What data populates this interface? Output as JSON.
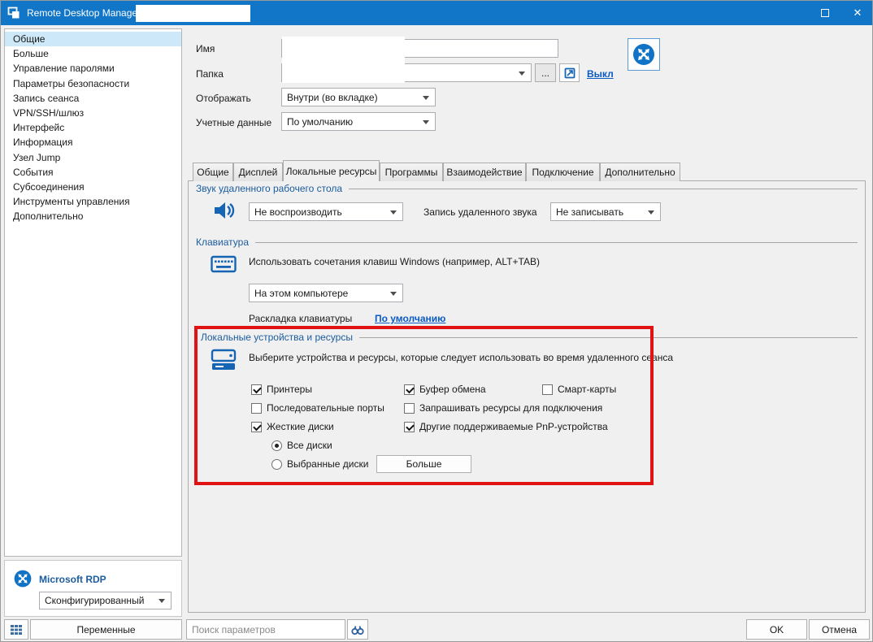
{
  "colors": {
    "titlebar_blue": "#1176c8",
    "accent_blue": "#1565b4",
    "annotation_red": "#e11212",
    "selection_blue": "#cde8f9",
    "group_header_blue": "#1b5c9e"
  },
  "titlebar": {
    "title": "Remote Desktop Manager -",
    "close_glyph": "✕"
  },
  "sidebar": {
    "items": [
      {
        "label": "Общие",
        "selected": true
      },
      {
        "label": "Больше",
        "selected": false
      },
      {
        "label": "Управление паролями",
        "selected": false
      },
      {
        "label": "Параметры безопасности",
        "selected": false
      },
      {
        "label": "Запись сеанса",
        "selected": false
      },
      {
        "label": "VPN/SSH/шлюз",
        "selected": false
      },
      {
        "label": "Интерфейс",
        "selected": false
      },
      {
        "label": "Информация",
        "selected": false
      },
      {
        "label": "Узел Jump",
        "selected": false
      },
      {
        "label": "События",
        "selected": false
      },
      {
        "label": "Субсоединения",
        "selected": false
      },
      {
        "label": "Инструменты управления",
        "selected": false
      },
      {
        "label": "Дополнительно",
        "selected": false
      }
    ],
    "footer": {
      "title": "Microsoft RDP",
      "state_value": "Сконфигурированный"
    }
  },
  "form": {
    "name_label": "Имя",
    "folder_label": "Папка",
    "ellipsis_button": "...",
    "off_link": "Выкл",
    "display_label": "Отображать",
    "display_value": "Внутри (во вкладке)",
    "credentials_label": "Учетные данные",
    "credentials_value": "По умолчанию"
  },
  "tabs": [
    {
      "label": "Общие",
      "selected": false
    },
    {
      "label": "Дисплей",
      "selected": false
    },
    {
      "label": "Локальные ресурсы",
      "selected": true
    },
    {
      "label": "Программы",
      "selected": false
    },
    {
      "label": "Взаимодействие",
      "selected": false
    },
    {
      "label": "Подключение",
      "selected": false
    },
    {
      "label": "Дополнительно",
      "selected": false
    }
  ],
  "sound": {
    "title": "Звук удаленного рабочего стола",
    "playback_value": "Не воспроизводить",
    "record_label": "Запись удаленного звука",
    "record_value": "Не записывать"
  },
  "keyboard": {
    "title": "Клавиатура",
    "shortcut_text": "Использовать сочетания клавиш Windows (например, ALT+TAB)",
    "apply_value": "На этом компьютере",
    "layout_label": "Раскладка клавиатуры",
    "layout_link": "По умолчанию"
  },
  "devices": {
    "title": "Локальные устройства и ресурсы",
    "description": "Выберите устройства и ресурсы, которые следует использовать во время удаленного сеанса",
    "checkboxes": [
      {
        "label": "Принтеры",
        "checked": true
      },
      {
        "label": "Буфер обмена",
        "checked": true
      },
      {
        "label": "Смарт-карты",
        "checked": false
      },
      {
        "label": "Последовательные порты",
        "checked": false
      },
      {
        "label": "Запрашивать ресурсы для подключения",
        "checked": false
      },
      {
        "label": "Жесткие диски",
        "checked": true
      },
      {
        "label": "Другие поддерживаемые PnP-устройства",
        "checked": true
      }
    ],
    "radios": [
      {
        "label": "Все диски",
        "selected": true
      },
      {
        "label": "Выбранные диски",
        "selected": false
      }
    ],
    "more_button": "Больше"
  },
  "bottombar": {
    "variables_button": "Переменные",
    "search_placeholder": "Поиск параметров",
    "ok_button": "OK",
    "cancel_button": "Отмена"
  }
}
